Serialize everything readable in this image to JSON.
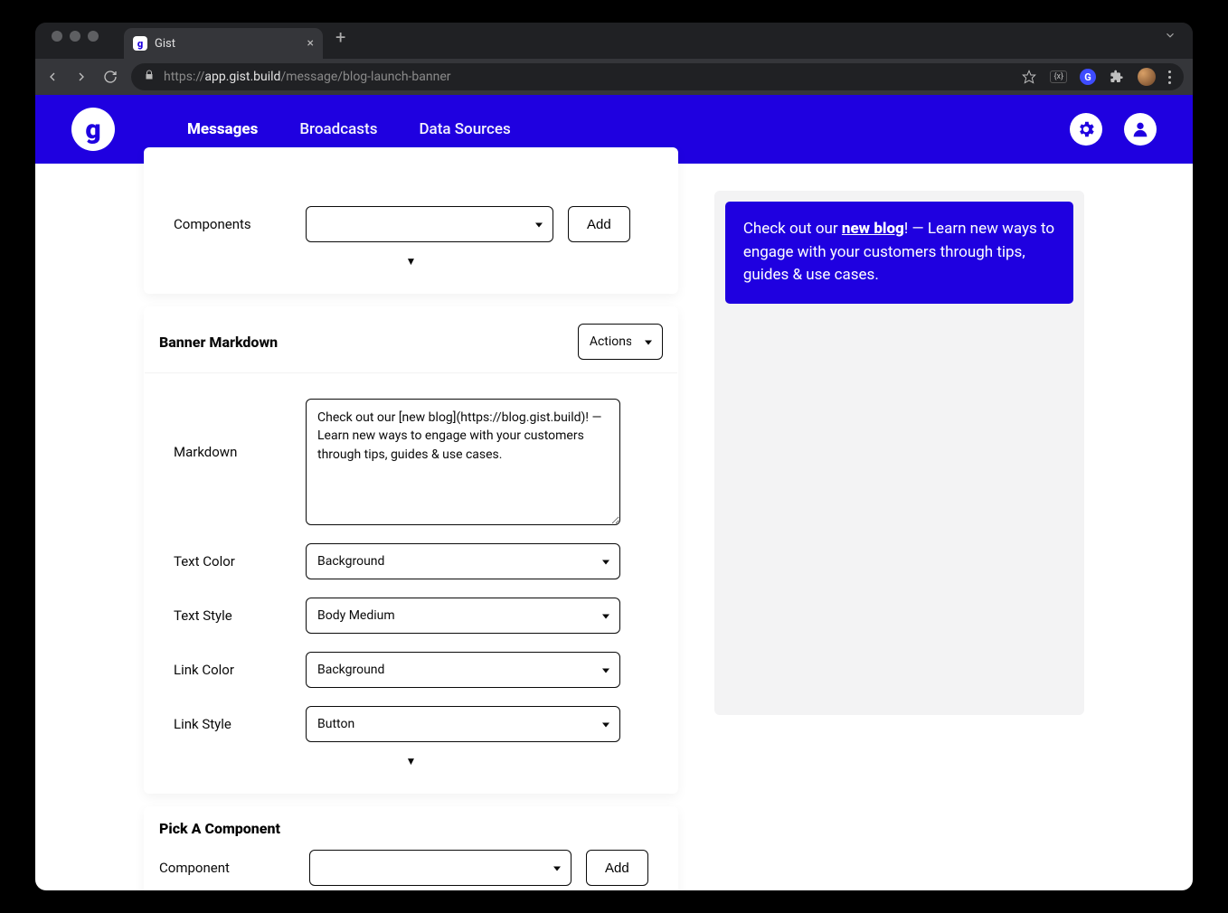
{
  "browser": {
    "tab_title": "Gist",
    "url_prefix": "https://",
    "url_host": "app.gist.build",
    "url_path": "/message/blog-launch-banner"
  },
  "nav": {
    "messages": "Messages",
    "broadcasts": "Broadcasts",
    "data_sources": "Data Sources"
  },
  "panel_top": {
    "components_label": "Components",
    "components_value": "",
    "add_button": "Add"
  },
  "banner_markdown": {
    "header": "Banner Markdown",
    "actions_label": "Actions",
    "markdown_label": "Markdown",
    "markdown_value": "Check out our [new blog](https://blog.gist.build)! — Learn new ways to engage with your customers through tips, guides & use cases.",
    "text_color_label": "Text Color",
    "text_color_value": "Background",
    "text_style_label": "Text Style",
    "text_style_value": "Body Medium",
    "link_color_label": "Link Color",
    "link_color_value": "Background",
    "link_style_label": "Link Style",
    "link_style_value": "Button"
  },
  "pick": {
    "header": "Pick A Component",
    "component_label": "Component",
    "component_value": "",
    "add_button": "Add"
  },
  "preview": {
    "pre": "Check out our ",
    "link": "new blog",
    "post": "! — Learn new ways to engage with your customers through tips, guides & use cases."
  }
}
